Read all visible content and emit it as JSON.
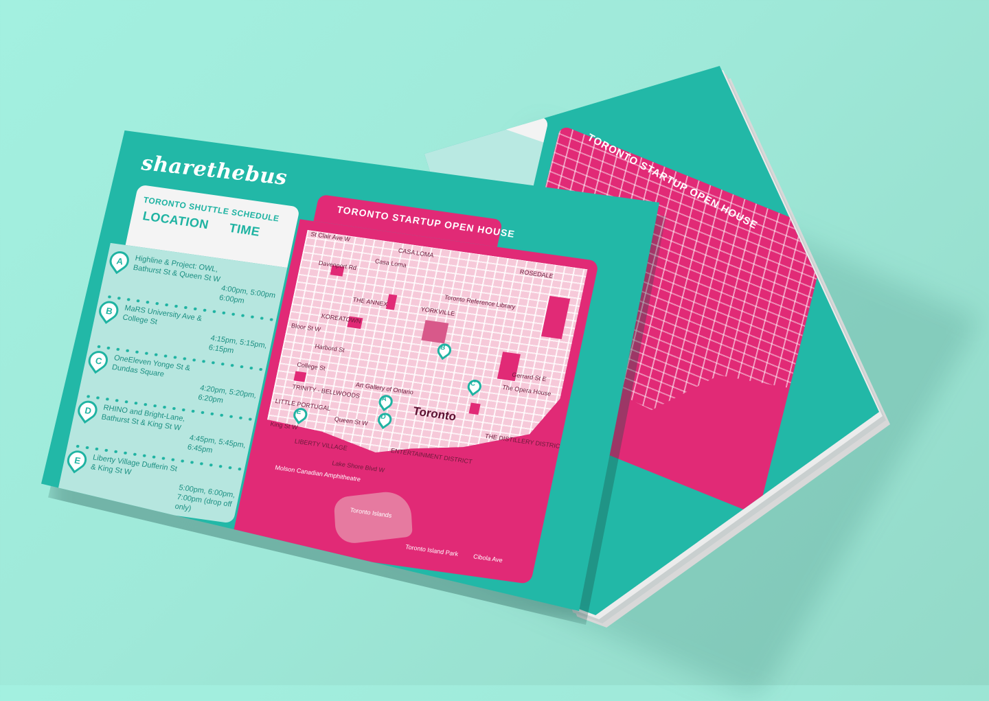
{
  "brand": {
    "logo_text": "sharethebus"
  },
  "schedule": {
    "title": "TORONTO SHUTTLE SCHEDULE",
    "col_location": "LOCATION",
    "col_time": "TIME",
    "stops": [
      {
        "letter": "A",
        "location": "Highline & Project: OWL, Bathurst St & Queen St W",
        "time": "4:00pm, 5:00pm 6:00pm"
      },
      {
        "letter": "B",
        "location": "MaRS University Ave & College St",
        "time": "4:15pm, 5:15pm, 6:15pm"
      },
      {
        "letter": "C",
        "location": "OneEleven Yonge St & Dundas Square",
        "time": "4:20pm, 5:20pm, 6:20pm"
      },
      {
        "letter": "D",
        "location": "RHINO and Bright-Lane, Bathurst St & King St W",
        "time": "4:45pm, 5:45pm, 6:45pm"
      },
      {
        "letter": "E",
        "location": "Liberty Village Dufferin St & King St W",
        "time": "5:00pm, 6:00pm, 7:00pm (drop off only)"
      }
    ]
  },
  "map": {
    "title": "TORONTO STARTUP OPEN HOUSE",
    "city_label": "Toronto",
    "labels": {
      "casa_loma_upper": "CASA LOMA",
      "casa_loma": "Casa Loma",
      "davenport": "Davenport Rd",
      "annex": "THE ANNEX",
      "yorkville": "YORKVILLE",
      "ref_library": "Toronto Reference Library",
      "koreatown": "KOREATOWN",
      "bloor": "Bloor St W",
      "harbord": "Harbord St",
      "college": "College St",
      "ago": "Art Gallery of Ontario",
      "trinity": "TRINITY - BELLWOODS",
      "little_portugal": "LITTLE PORTUGAL",
      "queen": "Queen St W",
      "king": "King St W",
      "liberty": "LIBERTY VILLAGE",
      "entertainment": "ENTERTAINMENT DISTRICT",
      "distillery": "THE DISTILLERY DISTRICT",
      "opera": "The Opera House",
      "gerrard": "Gerrard St E",
      "rosedale": "ROSEDALE",
      "lakeshore": "Lake Shore Blvd W",
      "molson": "Molson Canadian Amphitheatre",
      "islands": "Toronto Islands",
      "island_park": "Toronto Island Park",
      "cibola": "Cibola Ave",
      "clair": "St Clair Ave W"
    },
    "pins": [
      "A",
      "B",
      "C",
      "D",
      "E"
    ]
  },
  "colors": {
    "background": "#a3f0e0",
    "card_teal": "#22b8a7",
    "panel_mint": "#b6e6df",
    "map_pink": "#e12a76",
    "text_teal": "#1fb3a2"
  },
  "back_card": {
    "logo_text": "sharethebus",
    "schedule_title": "TORONTO SHUTTLE SCHEDULE",
    "map_title": "TORONTO STARTUP OPEN HOUSE"
  }
}
